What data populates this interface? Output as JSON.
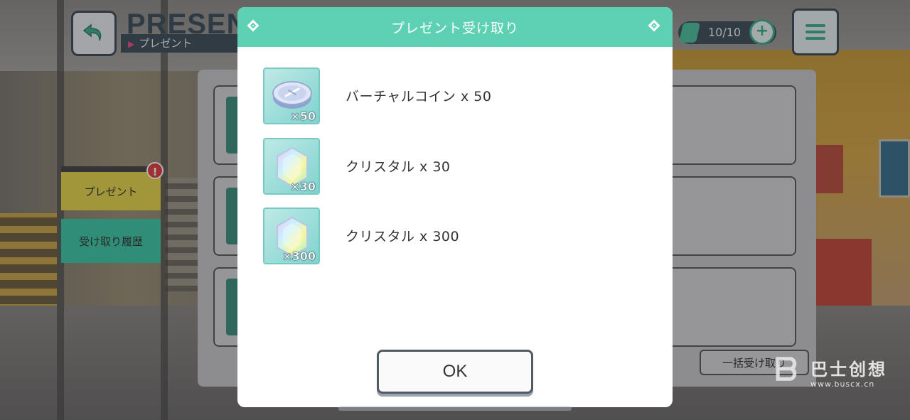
{
  "header": {
    "title_en": "PRESENT",
    "title_jp": "プレゼント"
  },
  "stamina": {
    "value": "10/10"
  },
  "side_tabs": [
    {
      "label": "プレゼント",
      "badge": "!"
    },
    {
      "label": "受け取り履歴"
    }
  ],
  "bulk_receive": {
    "label": "一括受け取り"
  },
  "modal": {
    "title": "プレゼント受け取り",
    "items": [
      {
        "icon": "virtual-coin-icon",
        "qty": "×50",
        "label": "バーチャルコイン x 50"
      },
      {
        "icon": "crystal-icon",
        "qty": "×30",
        "label": "クリスタル x 30"
      },
      {
        "icon": "crystal-icon",
        "qty": "×300",
        "label": "クリスタル x 300"
      }
    ],
    "ok_label": "OK"
  },
  "watermark": {
    "cn": "巴士创想",
    "url": "www.buscx.cn"
  },
  "colors": {
    "accent": "#5ed0b3",
    "present_tab": "#e6d54b",
    "history_tab": "#3fc8a4",
    "badge": "#e23f3f"
  }
}
